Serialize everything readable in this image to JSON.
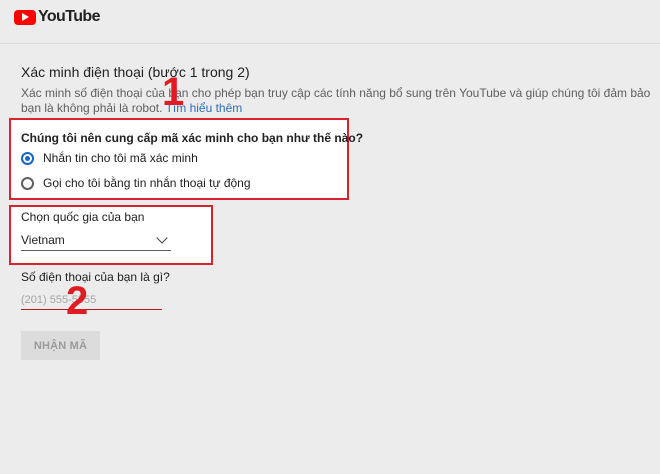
{
  "header": {
    "logo_text": "YouTube",
    "brand_color": "#ff0000"
  },
  "page": {
    "title": "Xác minh điện thoại (bước 1 trong 2)",
    "description": "Xác minh số điện thoại của bạn cho phép bạn truy cập các tính năng bổ sung trên YouTube và giúp chúng tôi đảm bảo bạn là không phải là robot.",
    "learn_more": "Tìm hiểu thêm"
  },
  "delivery": {
    "question": "Chúng tôi nên cung cấp mã xác minh cho bạn như thế nào?",
    "options": [
      {
        "label": "Nhắn tin cho tôi mã xác minh",
        "selected": true
      },
      {
        "label": "Gọi cho tôi bằng tin nhắn thoại tự động",
        "selected": false
      }
    ],
    "accent_color": "#1565c0"
  },
  "country": {
    "label": "Chọn quốc gia của bạn",
    "selected": "Vietnam"
  },
  "phone": {
    "label": "Số điện thoại của bạn là gì?",
    "placeholder": "(201) 555-5555",
    "value": ""
  },
  "submit": {
    "label": "NHẬN MÃ",
    "disabled": true
  },
  "annotations": {
    "step1": "1",
    "step2": "2",
    "color": "#e01b24"
  }
}
